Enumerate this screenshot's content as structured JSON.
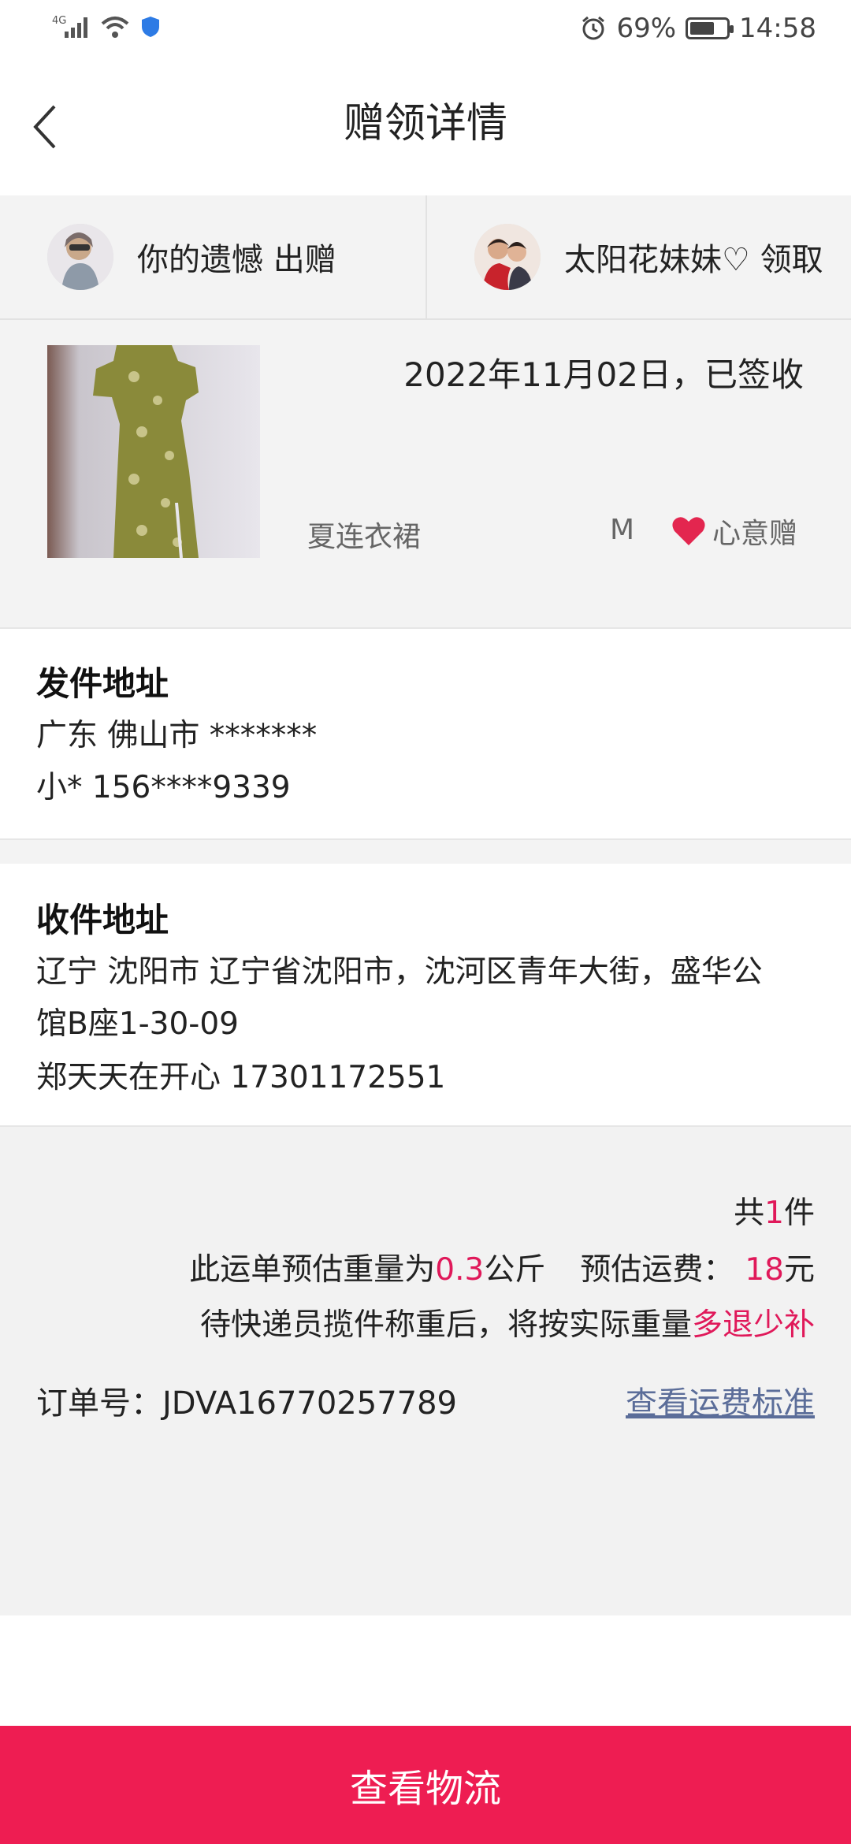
{
  "status_bar": {
    "network": "4G",
    "battery_percent": "69%",
    "battery_level": 0.69,
    "time": "14:58"
  },
  "header": {
    "title": "赠领详情",
    "back_icon": "chevron-left-icon"
  },
  "participants": {
    "giver": {
      "label": "你的遗憾 出赠"
    },
    "receiver": {
      "label": "太阳花妹妹♡ 领取"
    }
  },
  "item": {
    "date_status": "2022年11月02日，已签收",
    "name": "夏连衣裙",
    "size": "M",
    "gift_label": "心意赠",
    "gift_icon": "heart-icon",
    "gift_icon_color": "#e3264f"
  },
  "sender_address": {
    "heading": "发件地址",
    "region": "广东 佛山市 *******",
    "contact": "小* 156****9339"
  },
  "receiver_address": {
    "heading": "收件地址",
    "line1": "辽宁 沈阳市 辽宁省沈阳市，沈河区青年大街，盛华公",
    "line2": "馆B座1-30-09",
    "contact": "郑天天在开心 17301172551"
  },
  "summary": {
    "total_prefix": "共",
    "total_count": "1",
    "total_suffix": "件",
    "weight_prefix": "此运单预估重量为",
    "weight_value": "0.3",
    "weight_unit": "公斤",
    "fee_label": "预估运费：",
    "fee_value": "18",
    "fee_unit": "元",
    "note_prefix": "待快递员揽件称重后，将按实际重量",
    "note_highlight": "多退少补",
    "order_label": "订单号：JDVA16770257789",
    "fee_link": "查看运费标准",
    "accent_color": "#e0195a"
  },
  "bottom_button": {
    "label": "查看物流",
    "color": "#ee1d52"
  }
}
